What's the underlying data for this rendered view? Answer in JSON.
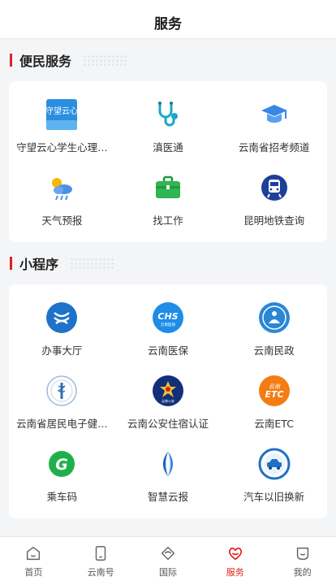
{
  "header": {
    "title": "服务"
  },
  "sections": [
    {
      "title": "便民服务",
      "items": [
        {
          "label": "守望云心学生心理…",
          "icon": "shouwang-yunxin-icon",
          "badge_text": "守望云心"
        },
        {
          "label": "滇医通",
          "icon": "stethoscope-icon"
        },
        {
          "label": "云南省招考频道",
          "icon": "graduation-cap-icon"
        },
        {
          "label": "天气预报",
          "icon": "weather-icon"
        },
        {
          "label": "找工作",
          "icon": "briefcase-icon"
        },
        {
          "label": "昆明地铁查询",
          "icon": "metro-icon"
        }
      ]
    },
    {
      "title": "小程序",
      "items": [
        {
          "label": "办事大厅",
          "icon": "service-hall-icon"
        },
        {
          "label": "云南医保",
          "icon": "medical-insurance-icon",
          "badge_text": "CHS",
          "badge_sub": "云南医保"
        },
        {
          "label": "云南民政",
          "icon": "civil-affairs-icon"
        },
        {
          "label": "云南省居民电子健…",
          "icon": "health-card-icon"
        },
        {
          "label": "云南公安住宿认证",
          "icon": "police-badge-icon",
          "badge_sub": "云南公安"
        },
        {
          "label": "云南ETC",
          "icon": "etc-icon",
          "badge_top": "云南",
          "badge_text": "ETC"
        },
        {
          "label": "乘车码",
          "icon": "ride-code-icon",
          "badge_text": "G"
        },
        {
          "label": "智慧云报",
          "icon": "yunbao-icon"
        },
        {
          "label": "汽车以旧换新",
          "icon": "car-trade-in-icon"
        }
      ]
    }
  ],
  "tabbar": [
    {
      "label": "首页",
      "icon": "home-icon",
      "active": false
    },
    {
      "label": "云南号",
      "icon": "yunnan-hao-icon",
      "active": false
    },
    {
      "label": "国际",
      "icon": "international-icon",
      "active": false
    },
    {
      "label": "服务",
      "icon": "service-heart-icon",
      "active": true
    },
    {
      "label": "我的",
      "icon": "profile-icon",
      "active": false
    }
  ],
  "colors": {
    "accent": "#e0211d",
    "background": "#f4f5f7",
    "card": "#ffffff"
  }
}
